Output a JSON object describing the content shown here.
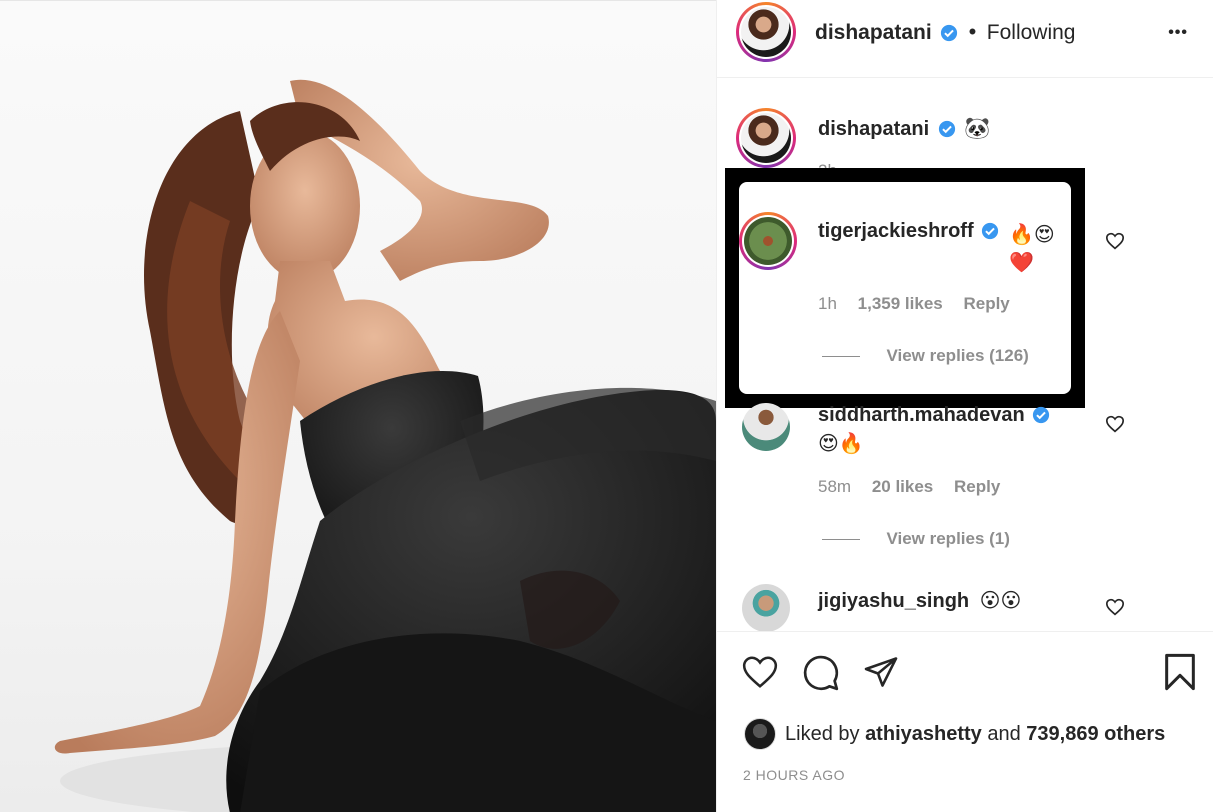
{
  "post": {
    "author": "dishapatani",
    "follow_status": "Following",
    "separator": "•",
    "more_label": "•••",
    "caption_emoji": "🐼",
    "caption_time": "2h"
  },
  "comments": [
    {
      "user": "tigerjackieshroff",
      "verified": true,
      "text": "🔥😍 ❤️",
      "time": "1h",
      "likes": "1,359 likes",
      "reply": "Reply",
      "view_replies": "View replies (126)"
    },
    {
      "user": "siddharth.mahadevan",
      "verified": true,
      "text": "😍🔥",
      "time": "58m",
      "likes": "20 likes",
      "reply": "Reply",
      "view_replies": "View replies (1)"
    },
    {
      "user": "jigiyashu_singh",
      "verified": false,
      "text": "😮😮"
    }
  ],
  "liked_by": {
    "prefix": "Liked by",
    "user": "athiyashetty",
    "conjunction": "and",
    "others": "739,869 others"
  },
  "timestamp": "2 HOURS AGO",
  "colors": {
    "verified": "#3897f0",
    "muted": "#8e8e8e",
    "text": "#262626"
  }
}
